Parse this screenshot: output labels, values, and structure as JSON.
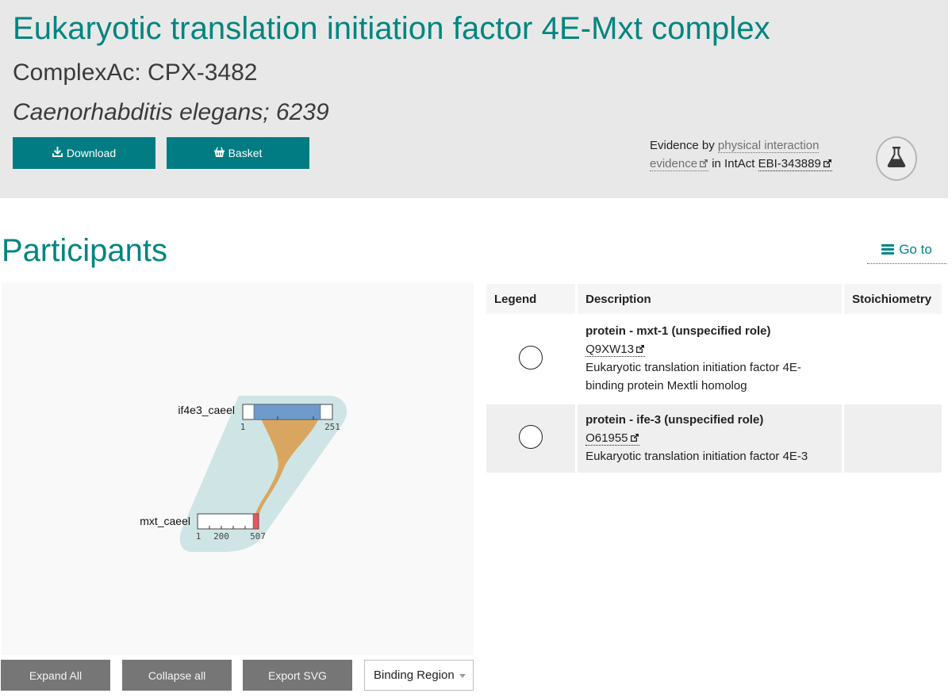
{
  "header": {
    "title": "Eukaryotic translation initiation factor 4E-Mxt complex",
    "complex_ac": "ComplexAc: CPX-3482",
    "organism": "Caenorhabditis elegans; 6239",
    "buttons": {
      "download": {
        "label": "Download",
        "icon": "download-icon"
      },
      "basket": {
        "label": "Basket",
        "icon": "basket-icon"
      }
    },
    "evidence": {
      "prefix": "Evidence by",
      "evidence_link": "physical interaction evidence",
      "middle": "in IntAct",
      "intact_id": "EBI-343889",
      "badge_icon": "flask-icon"
    },
    "colors": {
      "accent": "#00857f",
      "button": "#007c82",
      "panel": "#e8e8e8"
    }
  },
  "participants": {
    "title": "Participants",
    "goto_label": "Go to",
    "diagram": {
      "proteins": [
        {
          "name": "if4e3_caeel",
          "length": 251,
          "ticks": [
            "1",
            "251"
          ],
          "binding_region": [
            22,
            225
          ],
          "binding_color": "#6e9bcc"
        },
        {
          "name": "mxt_caeel",
          "length": 507,
          "ticks": [
            "1",
            "200",
            "507"
          ],
          "binding_region": [
            470,
            507
          ],
          "binding_color": "#e8545f"
        }
      ],
      "link_color": "#d9a25a",
      "complex_color": "#cde5e4"
    },
    "controls": {
      "expand_all": "Expand All",
      "collapse_all": "Collapse all",
      "export_svg": "Export SVG",
      "annotation_select": "Binding Region"
    },
    "table": {
      "headers": [
        "Legend",
        "Description",
        "Stoichiometry"
      ],
      "rows": [
        {
          "name": "protein - mxt-1 (unspecified role)",
          "accession": "Q9XW13",
          "description": "Eukaryotic translation initiation factor 4E-binding protein Mextli homolog",
          "stoichiometry": ""
        },
        {
          "name": "protein - ife-3 (unspecified role)",
          "accession": "O61955",
          "description": "Eukaryotic translation initiation factor 4E-3",
          "stoichiometry": ""
        }
      ]
    }
  }
}
